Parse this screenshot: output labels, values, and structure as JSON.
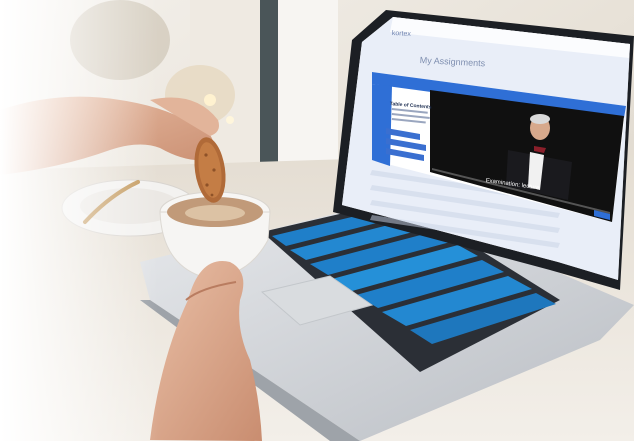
{
  "screen": {
    "brand": "kortex",
    "page_title": "My Assignments",
    "video_overlay": {
      "toc_title": "Table of Contents",
      "caption": "Examination: lecture"
    }
  },
  "colors": {
    "screen_bg": "#e9eef8",
    "overlay_header": "#2f6fd6",
    "video_bg": "#101010",
    "toc_button": "#3a6fd0"
  }
}
